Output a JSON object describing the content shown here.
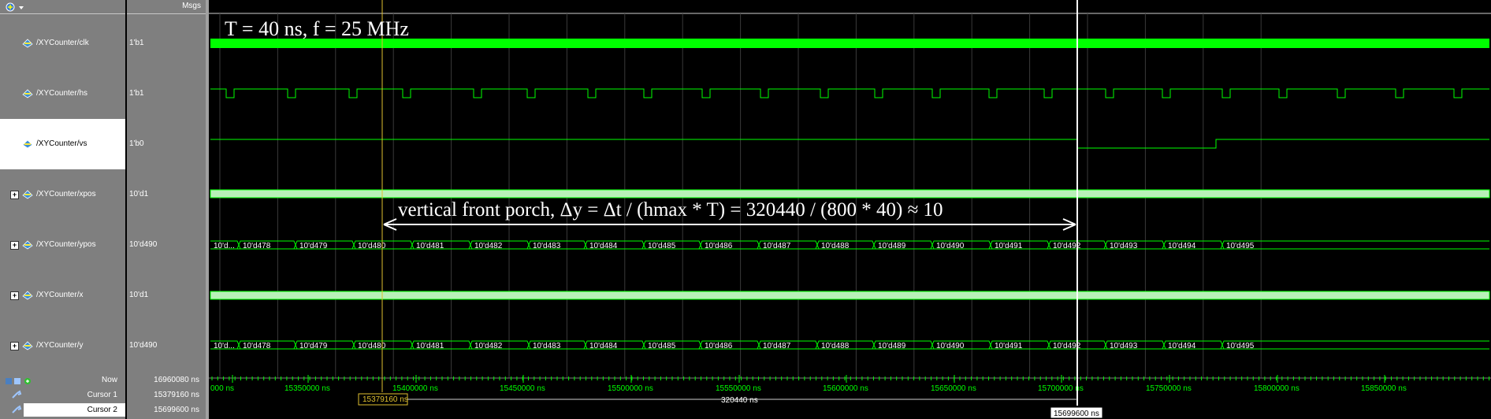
{
  "header": {
    "msgs_label": "Msgs"
  },
  "signals": [
    {
      "name": "/XYCounter/clk",
      "value": "1'b1",
      "expandable": false,
      "selected": false
    },
    {
      "name": "/XYCounter/hs",
      "value": "1'b1",
      "expandable": false,
      "selected": false
    },
    {
      "name": "/XYCounter/vs",
      "value": "1'b0",
      "expandable": false,
      "selected": true
    },
    {
      "name": "/XYCounter/xpos",
      "value": "10'd1",
      "expandable": true,
      "selected": false
    },
    {
      "name": "/XYCounter/ypos",
      "value": "10'd490",
      "expandable": true,
      "selected": false
    },
    {
      "name": "/XYCounter/x",
      "value": "10'd1",
      "expandable": true,
      "selected": false
    },
    {
      "name": "/XYCounter/y",
      "value": "10'd490",
      "expandable": true,
      "selected": false
    }
  ],
  "status_rows": [
    {
      "label": "Now",
      "value": "16960080 ns"
    },
    {
      "label": "Cursor 1",
      "value": "15379160 ns"
    },
    {
      "label": "Cursor 2",
      "value": "15699600 ns"
    }
  ],
  "annotations": {
    "title": "T = 40 ns, f = 25 MHz",
    "front_porch": "vertical front porch, Δy = Δt / (hmax * T) = 320440 / (800 * 40) ≈ 10"
  },
  "bus_values": {
    "first_partial": "10'd...",
    "list": [
      "10'd478",
      "10'd479",
      "10'd480",
      "10'd481",
      "10'd482",
      "10'd483",
      "10'd484",
      "10'd485",
      "10'd486",
      "10'd487",
      "10'd488",
      "10'd489",
      "10'd490",
      "10'd491",
      "10'd492",
      "10'd493",
      "10'd494",
      "10'd495"
    ]
  },
  "time_axis": {
    "labels": [
      "000 ns",
      "15350000 ns",
      "15400000 ns",
      "15450000 ns",
      "15500000 ns",
      "15550000 ns",
      "15600000 ns",
      "15650000 ns",
      "15700000 ns",
      "15750000 ns",
      "15800000 ns",
      "15850000 ns"
    ]
  },
  "cursors": {
    "cursor1_label": "15379160 ns",
    "cursor2_label": "15699600 ns",
    "delta_label": "320440 ns"
  },
  "colors": {
    "wave_green": "#00ff00",
    "bus_fill": "#b8f0b8",
    "cursor1": "#e0c030",
    "cursor2": "#ffffff",
    "panel_gray": "#7f7f7f"
  }
}
